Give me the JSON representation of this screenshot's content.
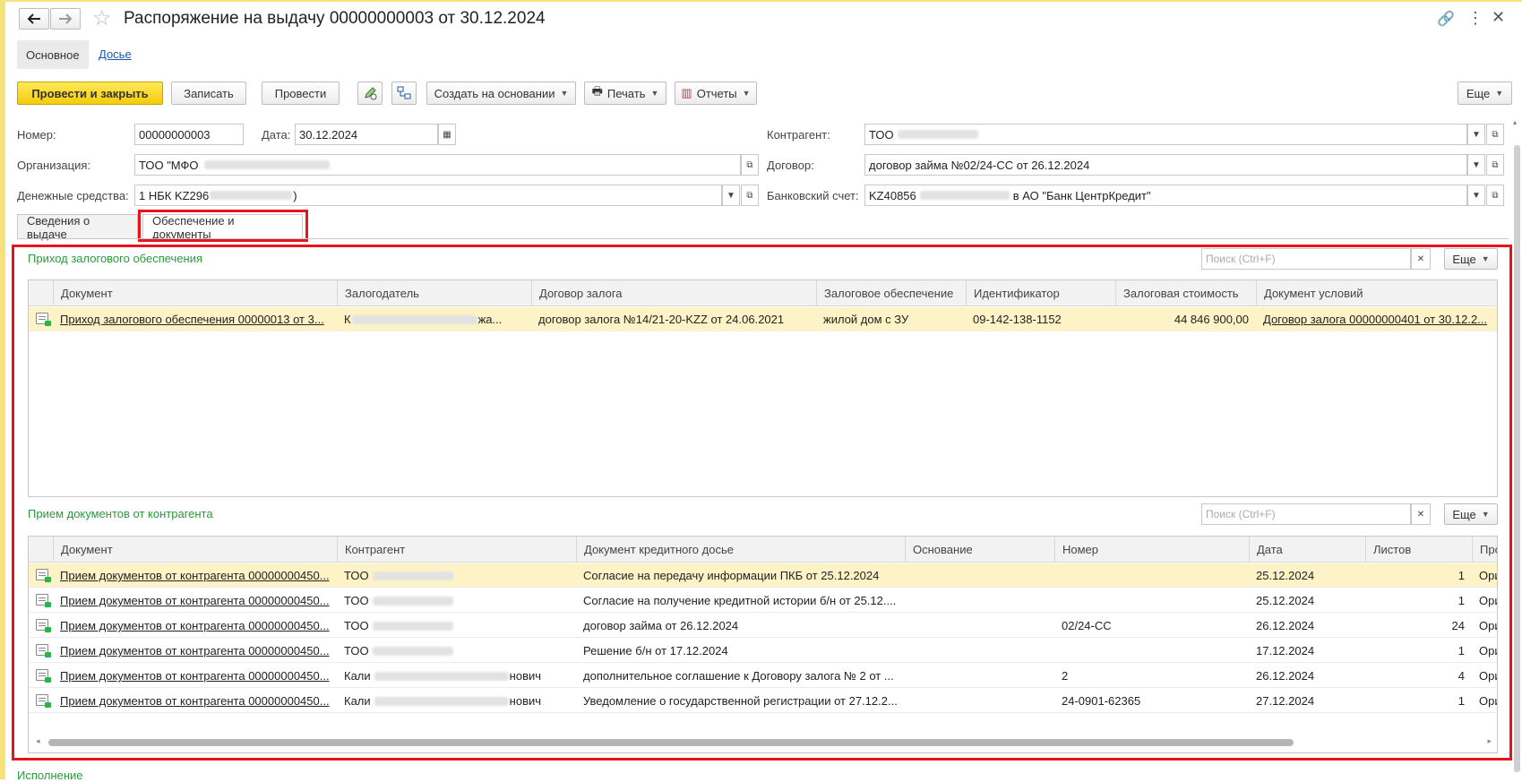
{
  "window": {
    "title": "Распоряжение на выдачу 00000000003 от 30.12.2024",
    "nav_tabs": [
      "Основное",
      "Досье"
    ]
  },
  "toolbar": {
    "post_close": "Провести и закрыть",
    "save": "Записать",
    "post": "Провести",
    "create_based": "Создать на основании",
    "print": "Печать",
    "reports": "Отчеты",
    "more": "Еще"
  },
  "form": {
    "number_label": "Номер:",
    "number_value": "00000000003",
    "date_label": "Дата:",
    "date_value": "30.12.2024",
    "org_label": "Организация:",
    "org_value": "ТОО \"МФО",
    "money_label": "Денежные средства:",
    "money_value_prefix": "1 НБК KZ296",
    "money_value_suffix": ")",
    "contractor_label": "Контрагент:",
    "contractor_value": "ТОО",
    "contract_label": "Договор:",
    "contract_value": "договор займа №02/24-СС от 26.12.2024",
    "bank_label": "Банковский счет:",
    "bank_value_prefix": "KZ40856",
    "bank_value_suffix": "в АО \"Банк ЦентрКредит\""
  },
  "tabs": [
    "Сведения о выдаче",
    "Обеспечение и документы"
  ],
  "pledge": {
    "title": "Приход залогового обеспечения",
    "search_placeholder": "Поиск (Ctrl+F)",
    "more": "Еще",
    "columns": [
      "Документ",
      "Залогодатель",
      "Договор залога",
      "Залоговое обеспечение",
      "Идентификатор",
      "Залоговая стоимость",
      "Документ условий"
    ],
    "rows": [
      {
        "doc": "Приход залогового обеспечения 00000013 от 3...",
        "pledger_start": "К",
        "pledger_end": "жа...",
        "contract": "договор залога №14/21-20-KZZ от 24.06.2021",
        "security": "жилой дом с ЗУ",
        "identifier": "09-142-138-1152",
        "value": "44 846 900,00",
        "terms_doc": "Договор залога 00000000401 от 30.12.2..."
      }
    ]
  },
  "docs": {
    "title": "Прием документов от контрагента",
    "search_placeholder": "Поиск (Ctrl+F)",
    "more": "Еще",
    "columns": [
      "Документ",
      "Контрагент",
      "Документ кредитного досье",
      "Основание",
      "Номер",
      "Дата",
      "Листов",
      "Про"
    ],
    "rows": [
      {
        "doc": "Прием документов от контрагента 00000000450...",
        "cp_start": "ТОО",
        "cp_end": "",
        "dossier": "Согласие на передачу информации ПКБ от 25.12.2024",
        "basis": "",
        "number": "",
        "date": "25.12.2024",
        "sheets": "1",
        "pro": "Ори"
      },
      {
        "doc": "Прием документов от контрагента 00000000450...",
        "cp_start": "ТОО",
        "cp_end": "",
        "dossier": "Согласие на получение кредитной истории б/н от 25.12....",
        "basis": "",
        "number": "",
        "date": "25.12.2024",
        "sheets": "1",
        "pro": "Ори"
      },
      {
        "doc": "Прием документов от контрагента 00000000450...",
        "cp_start": "ТОО",
        "cp_end": "",
        "dossier": "договор займа от 26.12.2024",
        "basis": "",
        "number": "02/24-СС",
        "date": "26.12.2024",
        "sheets": "24",
        "pro": "Ори"
      },
      {
        "doc": "Прием документов от контрагента 00000000450...",
        "cp_start": "ТОО",
        "cp_end": "",
        "dossier": "Решение б/н от 17.12.2024",
        "basis": "",
        "number": "",
        "date": "17.12.2024",
        "sheets": "1",
        "pro": "Ори"
      },
      {
        "doc": "Прием документов от контрагента 00000000450...",
        "cp_start": "Кали",
        "cp_end": "нович",
        "dossier": "дополнительное соглашение к Договору залога № 2 от ...",
        "basis": "",
        "number": "2",
        "date": "26.12.2024",
        "sheets": "4",
        "pro": "Ори"
      },
      {
        "doc": "Прием документов от контрагента 00000000450...",
        "cp_start": "Кали",
        "cp_end": "нович",
        "dossier": "Уведомление о государственной регистрации от 27.12.2...",
        "basis": "",
        "number": "24-0901-62365",
        "date": "27.12.2024",
        "sheets": "1",
        "pro": "Ори"
      }
    ]
  },
  "footer_section": "Исполнение",
  "colors": {
    "accent_yellow": "#f5cc0a",
    "highlight_red": "#e8141c",
    "section_green": "#2a9a3a",
    "selected_row": "#fdf3c7"
  }
}
